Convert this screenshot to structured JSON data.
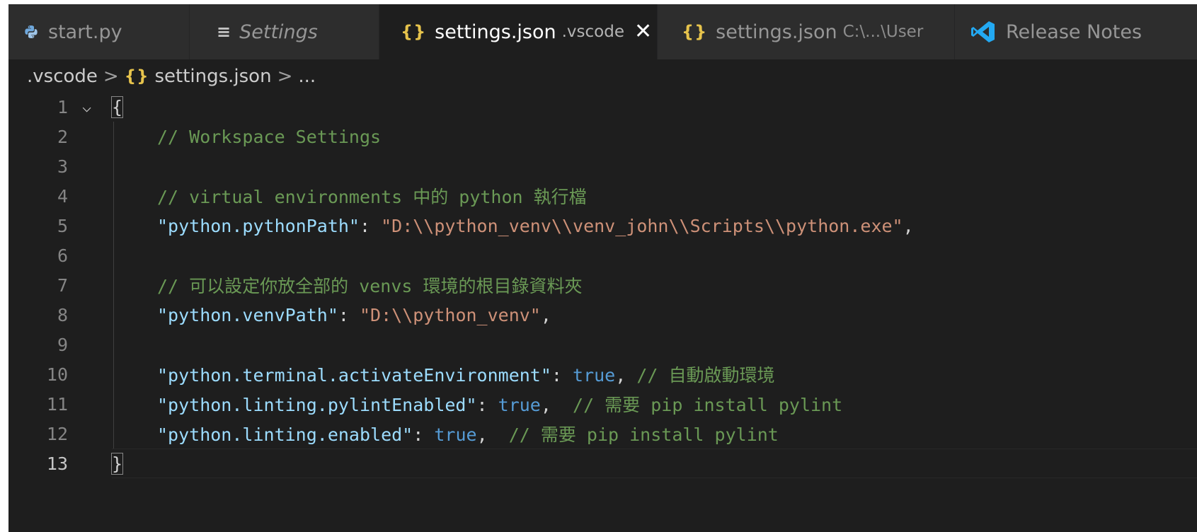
{
  "tabs": [
    {
      "label": "start.py",
      "icon": "python-icon",
      "active": false
    },
    {
      "label": "Settings",
      "icon": "menu-lines-icon",
      "active": false
    },
    {
      "label": "settings.json",
      "description": ".vscode",
      "icon": "json-braces-icon",
      "active": true,
      "close": "✕"
    },
    {
      "label": "settings.json",
      "description": "C:\\...\\User",
      "icon": "json-braces-icon",
      "active": false
    },
    {
      "label": "Release Notes",
      "icon": "vscode-logo-icon",
      "active": false
    }
  ],
  "breadcrumb": {
    "folder": ".vscode",
    "file": "settings.json",
    "symbol": "...",
    "sep": ">",
    "icon": "{}"
  },
  "editor": {
    "fold_glyph": "⌵",
    "lines": [
      {
        "n": "1",
        "parts": [
          {
            "t": "{",
            "c": "brace"
          }
        ]
      },
      {
        "n": "2",
        "parts": [
          {
            "t": "// Workspace Settings",
            "c": "cmt"
          }
        ]
      },
      {
        "n": "3",
        "parts": []
      },
      {
        "n": "4",
        "parts": [
          {
            "t": "// virtual environments 中的 python 執行檔",
            "c": "cmt"
          }
        ]
      },
      {
        "n": "5",
        "parts": [
          {
            "t": "\"python.pythonPath\"",
            "c": "key"
          },
          {
            "t": ": ",
            "c": "punc"
          },
          {
            "t": "\"D:\\\\python_venv\\\\venv_john\\\\Scripts\\\\python.exe\"",
            "c": "str"
          },
          {
            "t": ",",
            "c": "punc"
          }
        ]
      },
      {
        "n": "6",
        "parts": []
      },
      {
        "n": "7",
        "parts": [
          {
            "t": "// 可以設定你放全部的 venvs 環境的根目錄資料夾",
            "c": "cmt"
          }
        ]
      },
      {
        "n": "8",
        "parts": [
          {
            "t": "\"python.venvPath\"",
            "c": "key"
          },
          {
            "t": ": ",
            "c": "punc"
          },
          {
            "t": "\"D:\\\\python_venv\"",
            "c": "str"
          },
          {
            "t": ",",
            "c": "punc"
          }
        ]
      },
      {
        "n": "9",
        "parts": []
      },
      {
        "n": "10",
        "parts": [
          {
            "t": "\"python.terminal.activateEnvironment\"",
            "c": "key"
          },
          {
            "t": ": ",
            "c": "punc"
          },
          {
            "t": "true",
            "c": "bool"
          },
          {
            "t": ", ",
            "c": "punc"
          },
          {
            "t": "// 自動啟動環境",
            "c": "cmt"
          }
        ]
      },
      {
        "n": "11",
        "parts": [
          {
            "t": "\"python.linting.pylintEnabled\"",
            "c": "key"
          },
          {
            "t": ": ",
            "c": "punc"
          },
          {
            "t": "true",
            "c": "bool"
          },
          {
            "t": ",  ",
            "c": "punc"
          },
          {
            "t": "// 需要 pip install pylint",
            "c": "cmt"
          }
        ]
      },
      {
        "n": "12",
        "parts": [
          {
            "t": "\"python.linting.enabled\"",
            "c": "key"
          },
          {
            "t": ": ",
            "c": "punc"
          },
          {
            "t": "true",
            "c": "bool"
          },
          {
            "t": ",  ",
            "c": "punc"
          },
          {
            "t": "// 需要 pip install pylint",
            "c": "cmt"
          }
        ]
      },
      {
        "n": "13",
        "parts": [
          {
            "t": "}",
            "c": "brace"
          }
        ]
      }
    ]
  },
  "colors": {
    "editor_bg": "#1e1e1e",
    "tab_inactive_bg": "#2d2d2d",
    "json_icon": "#e6c34c",
    "python_blue": "#3776ab",
    "vscode_blue": "#23a9f2"
  }
}
